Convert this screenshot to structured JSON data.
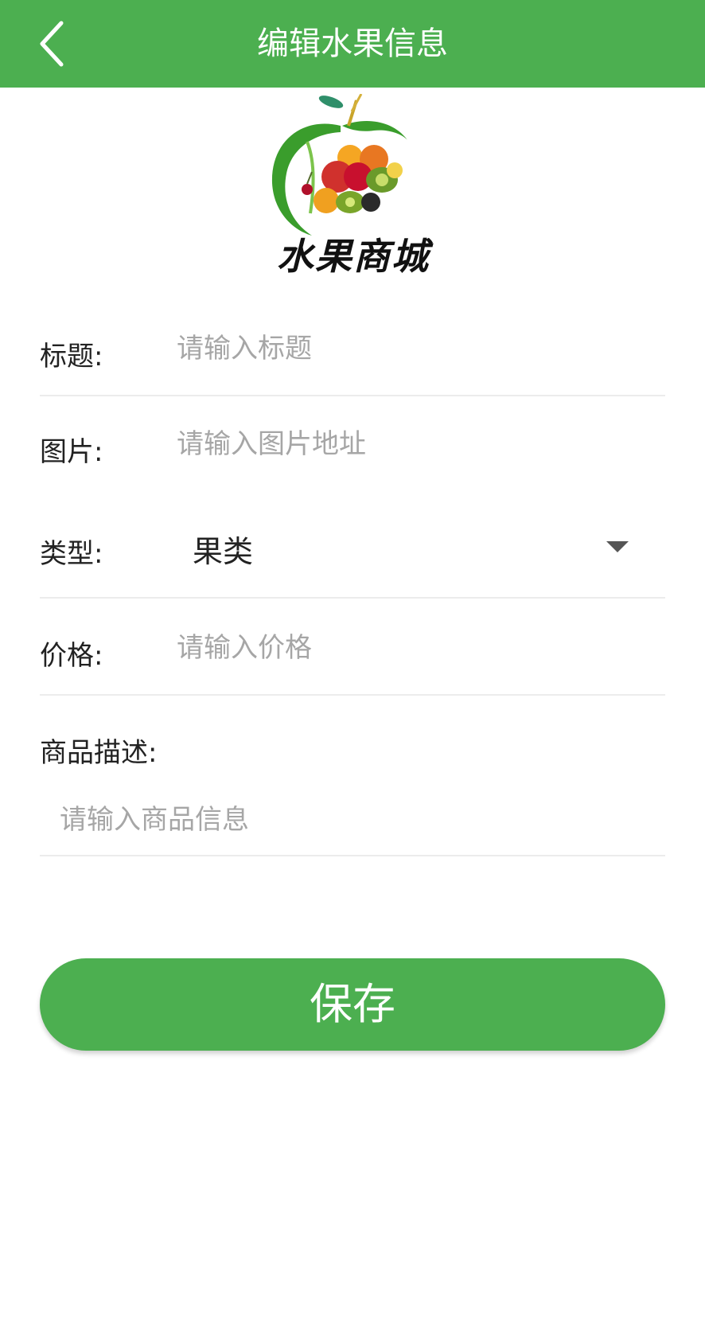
{
  "appbar": {
    "title": "编辑水果信息",
    "back_icon": "chevron-left-icon",
    "color": "#4caf50"
  },
  "logo": {
    "text": "水果商城"
  },
  "form": {
    "title_label": "标题:",
    "title_placeholder": "请输入标题",
    "image_label": "图片:",
    "image_placeholder": "请输入图片地址",
    "type_label": "类型:",
    "type_value": "果类",
    "price_label": "价格:",
    "price_placeholder": "请输入价格",
    "desc_label": "商品描述:",
    "desc_placeholder": "请输入商品信息"
  },
  "save_button": {
    "label": "保存",
    "color": "#4caf50"
  }
}
